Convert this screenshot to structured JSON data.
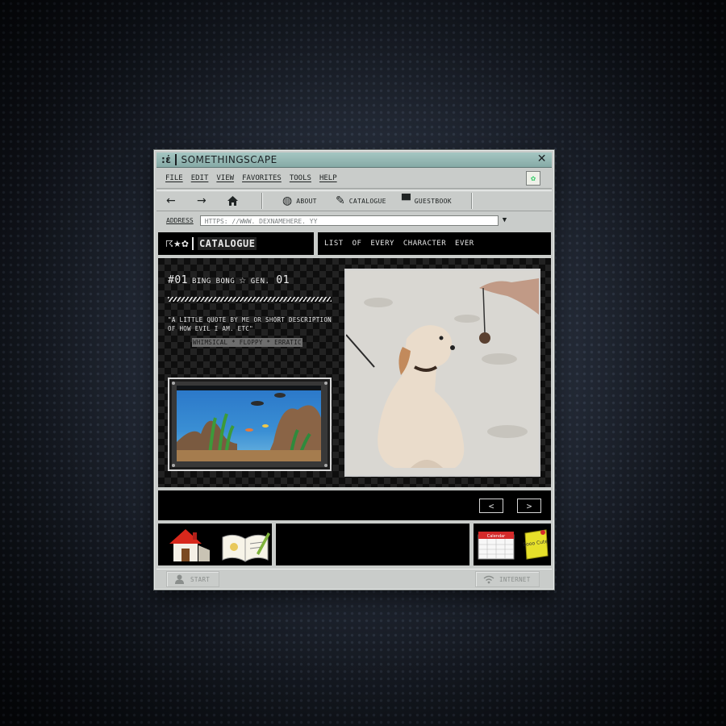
{
  "window": {
    "title": "SOMETHINGSCAPE",
    "logo": ":ἐ"
  },
  "menu": {
    "items": [
      "FILE",
      "EDIT",
      "VIEW",
      "FAVORITES",
      "TOOLS",
      "HELP"
    ]
  },
  "toolbar": {
    "about_label": "ABOUT",
    "catalogue_label": "CATALOGUE",
    "guestbook_label": "GUESTBOOK"
  },
  "address": {
    "label": "ADDRESS",
    "value": "HTTPS: //WWW. DEXNAMEHERE. YY"
  },
  "header": {
    "emoji": "☈★✿",
    "title": "CATALOGUE",
    "subtitle": "LIST OF EVERY CHARACTER EVER"
  },
  "character": {
    "number": "#01",
    "name": "BING BONG",
    "star": "☆",
    "gen_label": "GEN.",
    "gen_value": "01",
    "quote": "\"A LITTLE QUOTE BY ME OR SHORT DESCRIPTION OF HOW EVIL I AM. ETC\"",
    "tags": "WHIMSICAL * FLOPPY * ERRATIC"
  },
  "pager": {
    "prev": "<",
    "next": ">"
  },
  "statusbar": {
    "start_label": "START",
    "internet_label": "INTERNET"
  },
  "desktop_icons": {
    "sticky_note": "Sooo Cute",
    "calendar": "Calendar"
  },
  "colors": {
    "title_bar": "#93b5b1",
    "chrome": "#c9ccca",
    "panel": "#000000"
  }
}
